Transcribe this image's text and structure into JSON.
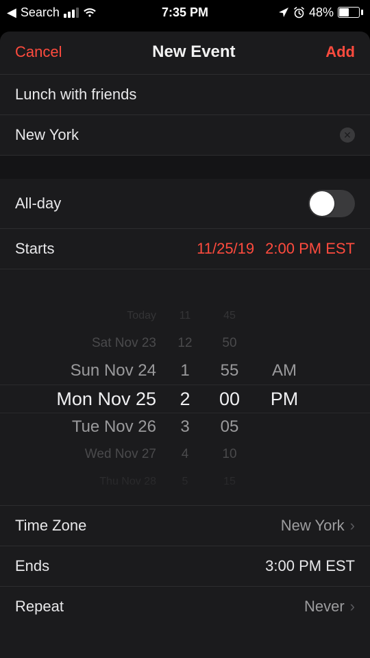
{
  "status": {
    "back_label": "Search",
    "time": "7:35 PM",
    "battery_pct": "48%"
  },
  "nav": {
    "cancel": "Cancel",
    "title": "New Event",
    "add": "Add"
  },
  "event": {
    "title": "Lunch with friends",
    "location": "New York"
  },
  "allday": {
    "label": "All-day",
    "value": false
  },
  "starts": {
    "label": "Starts",
    "date": "11/25/19",
    "time": "2:00 PM EST"
  },
  "picker": {
    "rows": [
      {
        "cls": "xfar",
        "date": "",
        "h": "",
        "m": "",
        "ap": ""
      },
      {
        "cls": "xfar",
        "date": "Today",
        "h": "11",
        "m": "45",
        "ap": ""
      },
      {
        "cls": "far",
        "date": "Sat Nov 23",
        "h": "12",
        "m": "50",
        "ap": ""
      },
      {
        "cls": "near",
        "date": "Sun Nov 24",
        "h": "1",
        "m": "55",
        "ap": "AM"
      },
      {
        "cls": "sel",
        "date": "Mon Nov 25",
        "h": "2",
        "m": "00",
        "ap": "PM"
      },
      {
        "cls": "near",
        "date": "Tue Nov 26",
        "h": "3",
        "m": "05",
        "ap": ""
      },
      {
        "cls": "far",
        "date": "Wed Nov 27",
        "h": "4",
        "m": "10",
        "ap": ""
      },
      {
        "cls": "xfar",
        "date": "Thu Nov 28",
        "h": "5",
        "m": "15",
        "ap": ""
      }
    ]
  },
  "timezone": {
    "label": "Time Zone",
    "value": "New York"
  },
  "ends": {
    "label": "Ends",
    "value": "3:00 PM EST"
  },
  "repeat": {
    "label": "Repeat",
    "value": "Never"
  },
  "colors": {
    "accent": "#ff4b3e"
  }
}
